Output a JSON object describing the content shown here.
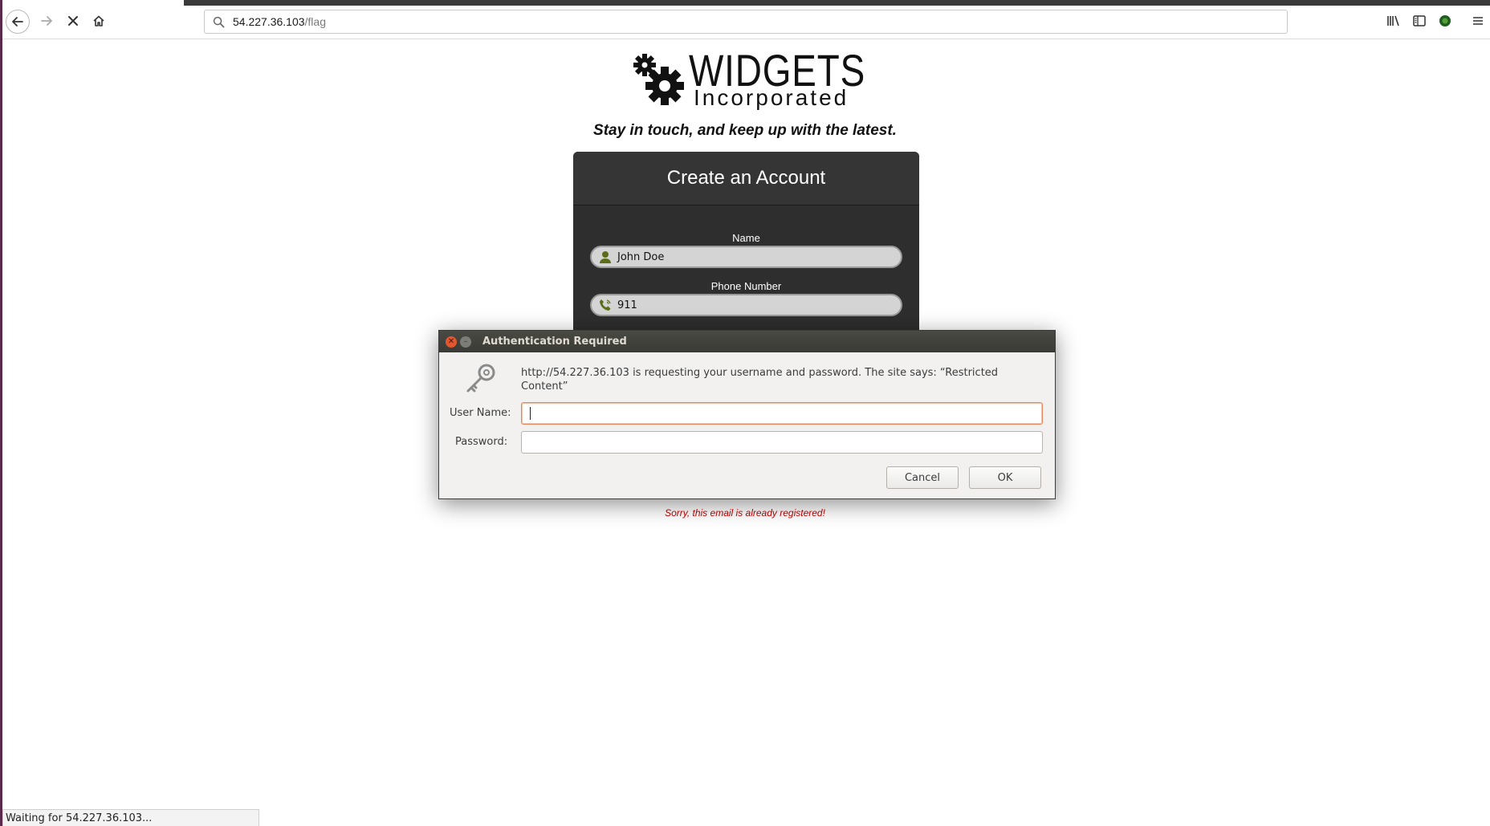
{
  "browser": {
    "url_host": "54.227.36.103",
    "url_path": "/flag",
    "status_text": "Waiting for 54.227.36.103..."
  },
  "page": {
    "logo_word": "WIDGETS",
    "logo_sub": "Incorporated",
    "tagline": "Stay in touch, and keep up with the latest.",
    "form": {
      "title": "Create an Account",
      "name_label": "Name",
      "name_value": "John Doe",
      "phone_label": "Phone Number",
      "phone_value": "911"
    },
    "error_message": "Sorry, this email is already registered!"
  },
  "dialog": {
    "title": "Authentication Required",
    "message": "http://54.227.36.103 is requesting your username and password. The site says: “Restricted Content”",
    "username_label": "User Name:",
    "username_value": "",
    "password_label": "Password:",
    "password_value": "",
    "cancel_label": "Cancel",
    "ok_label": "OK"
  },
  "colors": {
    "accent_error": "#cc0000",
    "card_bg": "#2e2e2e",
    "dialog_title_bg": "#3a3a36",
    "close_button": "#e4572e"
  }
}
